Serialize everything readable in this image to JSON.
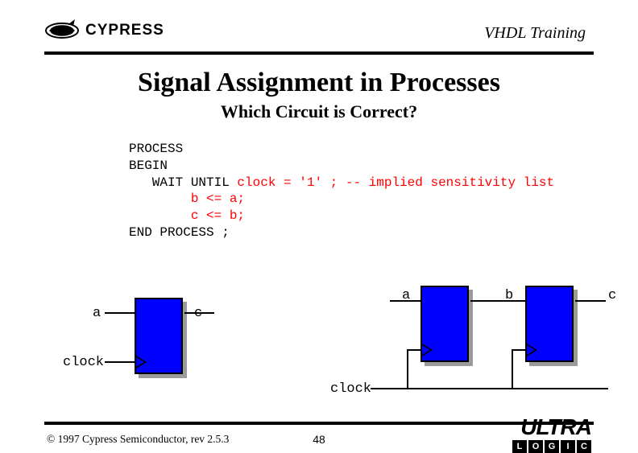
{
  "header": {
    "brand": "CYPRESS",
    "course": "VHDL Training"
  },
  "title": "Signal Assignment in Processes",
  "subtitle": "Which Circuit is Correct?",
  "code": {
    "l1": "PROCESS",
    "l2": "BEGIN",
    "l3a": "   WAIT UNTIL ",
    "l3b": "clock = '1' ; ",
    "l3c": "-- implied sensitivity list",
    "l4": "        b <= a;",
    "l5": "        c <= b;",
    "l6": "END PROCESS ;"
  },
  "signals": {
    "a": "a",
    "b": "b",
    "c": "c",
    "clock": "clock"
  },
  "footer": {
    "copyright": "© 1997 Cypress Semiconductor, rev 2.5.3",
    "page": "48",
    "ultra": "ULTRA",
    "ultra_boxes": [
      "L",
      "O",
      "G",
      "I",
      "C"
    ]
  }
}
